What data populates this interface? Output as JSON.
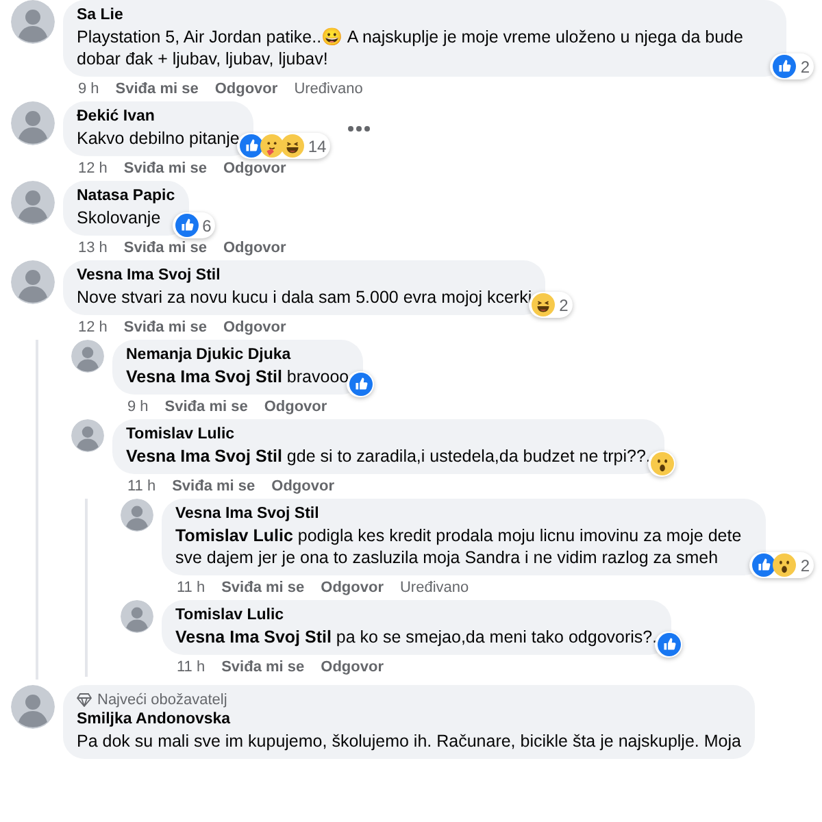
{
  "comments": [
    {
      "author": "Sa Lie",
      "text": "Playstation 5, Air Jordan patike..😀 A najskuplje je moje vreme uloženo u njega da bude dobar đak + ljubav, ljubav, ljubav!",
      "time": "9 h",
      "like": "Sviđa mi se",
      "reply": "Odgovor",
      "edited": "Uređivano",
      "reactions": {
        "kinds": [
          {
            "kind": "like"
          }
        ],
        "count": "2"
      }
    },
    {
      "author": "Đekić Ivan",
      "text": "Kakvo debilno pitanje",
      "time": "12 h",
      "like": "Sviđa mi se",
      "reply": "Odgovor",
      "more": true,
      "reactions": {
        "kinds": [
          {
            "kind": "like"
          },
          {
            "kind": "care"
          },
          {
            "kind": "haha"
          }
        ],
        "count": "14"
      }
    },
    {
      "author": "Natasa Papic",
      "text": "Skolovanje",
      "time": "13 h",
      "like": "Sviđa mi se",
      "reply": "Odgovor",
      "reactions": {
        "kinds": [
          {
            "kind": "like"
          }
        ],
        "count": "6"
      }
    },
    {
      "author": "Vesna Ima Svoj Stil",
      "text": "Nove stvari za novu kucu i dala sam 5.000 evra mojoj kcerki",
      "time": "12 h",
      "like": "Sviđa mi se",
      "reply": "Odgovor",
      "reactions": {
        "kinds": [
          {
            "kind": "haha"
          }
        ],
        "count": "2"
      },
      "children": [
        {
          "author": "Nemanja Djukic Djuka",
          "text": "**Vesna Ima Svoj Stil** bravooo",
          "time": "9 h",
          "like": "Sviđa mi se",
          "reply": "Odgovor",
          "reactions": {
            "kinds": [
              {
                "kind": "like"
              }
            ]
          }
        },
        {
          "author": "Tomislav Lulic",
          "text": "**Vesna Ima Svoj Stil** gde si to zaradila,i ustedela,da budzet ne trpi??.",
          "time": "11 h",
          "like": "Sviđa mi se",
          "reply": "Odgovor",
          "reactions": {
            "kinds": [
              {
                "kind": "wow"
              }
            ]
          },
          "children": [
            {
              "author": "Vesna Ima Svoj Stil",
              "text": "**Tomislav Lulic** podigla kes kredit prodala moju licnu imovinu za moje dete sve dajem jer je ona to zasluzila moja Sandra i ne vidim razlog za smeh",
              "time": "11 h",
              "like": "Sviđa mi se",
              "reply": "Odgovor",
              "edited": "Uređivano",
              "reactions": {
                "kinds": [
                  {
                    "kind": "like"
                  },
                  {
                    "kind": "wow"
                  }
                ],
                "count": "2"
              }
            },
            {
              "author": "Tomislav Lulic",
              "text": "**Vesna Ima Svoj Stil** pa ko se smejao,da meni tako odgovoris?.",
              "time": "11 h",
              "like": "Sviđa mi se",
              "reply": "Odgovor",
              "reactions": {
                "kinds": [
                  {
                    "kind": "like"
                  }
                ]
              }
            }
          ]
        }
      ]
    },
    {
      "badge": "Najveći obožavatelj",
      "author": "Smiljka Andonovska",
      "text": "Pa dok su mali sve im kupujemo, školujemo ih. Računare, bicikle šta je najskuplje. Moja"
    }
  ]
}
